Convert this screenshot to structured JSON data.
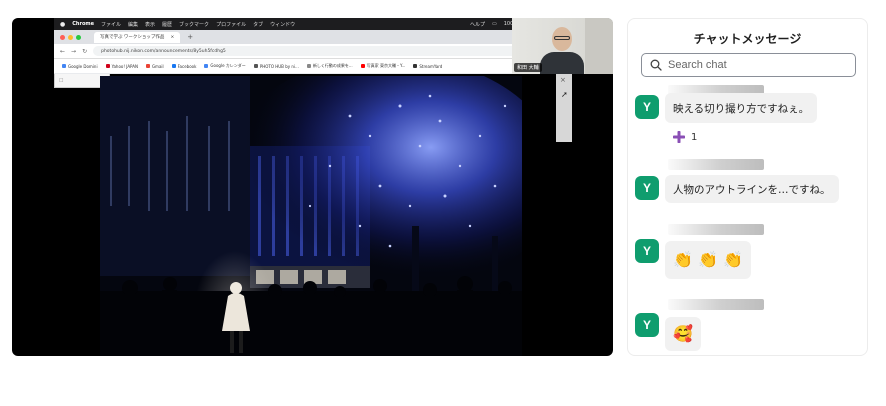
{
  "shared_screen": {
    "mac_menu": {
      "app": "Chrome",
      "items": [
        "ファイル",
        "編集",
        "表示",
        "履歴",
        "ブックマーク",
        "プロファイル",
        "タブ",
        "ウィンドウ"
      ],
      "right_items": [
        "ヘルプ",
        "100%"
      ]
    },
    "browser": {
      "tab_title": "写真で学ぶ ワークショップ作品",
      "url": "photohub.nij.nikon.com/announcements/8y5uh5fcdhg5",
      "bookmarks": [
        "Google Domini",
        "Yahoo! JAPAN",
        "Gmail",
        "Facebook",
        "Google カレンダー",
        "PHOTO HUB by ni...",
        "新しく行動の成果を...",
        "写真家 東京大輔・Y...",
        "StreamYard"
      ]
    },
    "webcam": {
      "name": "和田 大輔"
    }
  },
  "chat": {
    "title": "チャットメッセージ",
    "search_placeholder": "Search chat",
    "messages": [
      {
        "avatar": "Y",
        "text": "映える切り撮り方ですねぇ。",
        "reaction": {
          "emoji": "+",
          "count": "1"
        }
      },
      {
        "avatar": "Y",
        "text": "人物のアウトラインを…ですね。"
      },
      {
        "avatar": "Y",
        "text": "👏 👏 👏"
      },
      {
        "avatar": "Y",
        "text": "🥰"
      }
    ]
  },
  "colors": {
    "avatar": "#0f9d6e",
    "reaction_plus": "#8a4fb5",
    "bubble": "#f1f1f1"
  }
}
